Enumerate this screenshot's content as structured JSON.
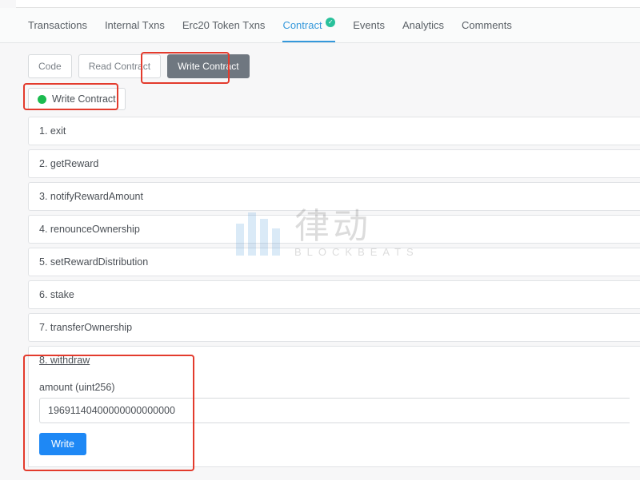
{
  "tabs": {
    "transactions": "Transactions",
    "internal_txns": "Internal Txns",
    "erc20": "Erc20 Token Txns",
    "contract": "Contract",
    "events": "Events",
    "analytics": "Analytics",
    "comments": "Comments"
  },
  "subtabs": {
    "code": "Code",
    "read": "Read Contract",
    "write": "Write Contract"
  },
  "status": {
    "label": "Write Contract"
  },
  "functions": {
    "f1": "1. exit",
    "f2": "2. getReward",
    "f3": "3. notifyRewardAmount",
    "f4": "4. renounceOwnership",
    "f5": "5. setRewardDistribution",
    "f6": "6. stake",
    "f7": "7. transferOwnership",
    "f8": "8. withdraw"
  },
  "withdraw": {
    "param_label": "amount (uint256)",
    "param_value": "19691140400000000000000",
    "button": "Write"
  },
  "watermark": {
    "main": "律动",
    "sub": "BLOCKBEATS"
  }
}
